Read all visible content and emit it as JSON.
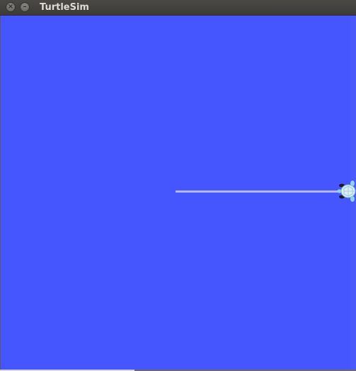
{
  "window": {
    "title": "TurtleSim",
    "close_glyph": "×",
    "minimize_glyph": "–"
  },
  "canvas": {
    "background_color": "#4556ff",
    "pen_color": "#b3b8ff"
  },
  "icons": {
    "turtle": "turtle-icon"
  }
}
